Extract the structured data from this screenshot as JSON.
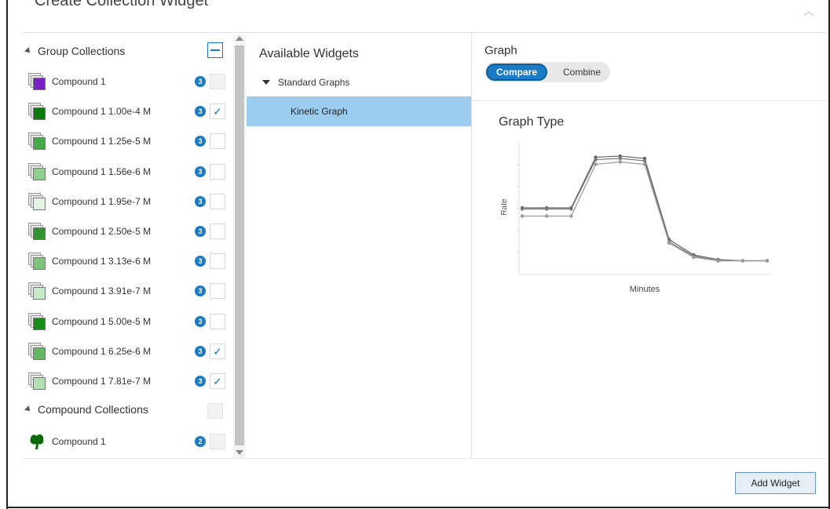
{
  "dialog": {
    "title": "Create Collection Widget",
    "close_icon": "chevron-up-icon"
  },
  "colors": {
    "accent": "#1a7ac4",
    "selection": "#9ccdef",
    "purple": "#7b22c4"
  },
  "group_collections": {
    "label": "Group Collections",
    "items": [
      {
        "label": "Compound 1",
        "count": "3",
        "checked": false,
        "disabled": true,
        "color": "#7b22c4"
      },
      {
        "label": "Compound 1 1.00e-4 M",
        "count": "3",
        "checked": true,
        "disabled": false,
        "color": "#0a7a0a"
      },
      {
        "label": "Compound 1 1.25e-5 M",
        "count": "3",
        "checked": false,
        "disabled": false,
        "color": "#46a846"
      },
      {
        "label": "Compound 1 1.56e-6 M",
        "count": "3",
        "checked": false,
        "disabled": false,
        "color": "#8fd08f"
      },
      {
        "label": "Compound 1 1.95e-7 M",
        "count": "3",
        "checked": false,
        "disabled": false,
        "color": "#e3f4e3"
      },
      {
        "label": "Compound 1 2.50e-5 M",
        "count": "3",
        "checked": false,
        "disabled": false,
        "color": "#2e962e"
      },
      {
        "label": "Compound 1 3.13e-6 M",
        "count": "3",
        "checked": false,
        "disabled": false,
        "color": "#7cc47c"
      },
      {
        "label": "Compound 1 3.91e-7 M",
        "count": "3",
        "checked": false,
        "disabled": false,
        "color": "#c8eac8"
      },
      {
        "label": "Compound 1 5.00e-5 M",
        "count": "3",
        "checked": false,
        "disabled": false,
        "color": "#178c17"
      },
      {
        "label": "Compound 1 6.25e-6 M",
        "count": "3",
        "checked": true,
        "disabled": false,
        "color": "#64b864"
      },
      {
        "label": "Compound 1 7.81e-7 M",
        "count": "3",
        "checked": true,
        "disabled": false,
        "color": "#b2e0b2"
      }
    ]
  },
  "compound_collections": {
    "label": "Compound Collections",
    "items": [
      {
        "label": "Compound 1",
        "count": "2",
        "checked": false,
        "disabled": true,
        "color": "#0a6a0a"
      }
    ]
  },
  "available_widgets": {
    "title": "Available Widgets",
    "group": "Standard Graphs",
    "selected": "Kinetic Graph"
  },
  "graph": {
    "title": "Graph",
    "toggle": {
      "compare": "Compare",
      "combine": "Combine",
      "active": "Compare"
    },
    "type_title": "Graph Type"
  },
  "chart_data": {
    "type": "line",
    "xlabel": "Minutes",
    "ylabel": "Rate",
    "x": [
      1,
      2,
      3,
      4,
      5,
      6,
      7,
      8,
      9,
      10,
      11
    ],
    "ylim": [
      0,
      100
    ],
    "grid": false,
    "series": [
      {
        "values": [
          54,
          54,
          54,
          97,
          98,
          96,
          27,
          14,
          10,
          9,
          9
        ]
      },
      {
        "values": [
          53,
          53,
          53,
          95,
          96,
          94,
          25,
          13,
          9,
          9,
          9
        ]
      },
      {
        "values": [
          47,
          47,
          47,
          91,
          93,
          91,
          24,
          12,
          9,
          9,
          9
        ]
      }
    ]
  },
  "footer": {
    "add_label": "Add Widget"
  }
}
